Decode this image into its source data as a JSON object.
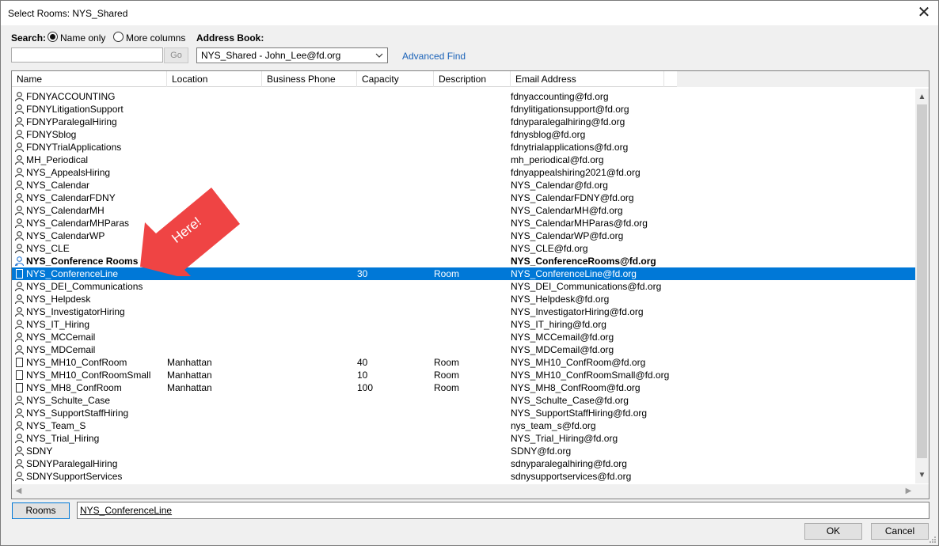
{
  "window": {
    "title": "Select Rooms: NYS_Shared"
  },
  "search": {
    "label": "Search:",
    "option_name_only": "Name only",
    "option_more_columns": "More columns",
    "selected": "Name only",
    "value": "",
    "go_label": "Go"
  },
  "address_book": {
    "label": "Address Book:",
    "selected": "NYS_Shared - John_Lee@fd.org",
    "advanced_find": "Advanced Find"
  },
  "columns": [
    "Name",
    "Location",
    "Business Phone",
    "Capacity",
    "Description",
    "Email Address"
  ],
  "rows": [
    {
      "icon": "person-icon",
      "name": "FDNYACCOUNTING",
      "location": "",
      "phone": "",
      "capacity": "",
      "description": "",
      "email": "fdnyaccounting@fd.org"
    },
    {
      "icon": "person-icon",
      "name": "FDNYLitigationSupport",
      "location": "",
      "phone": "",
      "capacity": "",
      "description": "",
      "email": "fdnylitigationsupport@fd.org"
    },
    {
      "icon": "person-icon",
      "name": "FDNYParalegalHiring",
      "location": "",
      "phone": "",
      "capacity": "",
      "description": "",
      "email": "fdnyparalegalhiring@fd.org"
    },
    {
      "icon": "person-icon",
      "name": "FDNYSblog",
      "location": "",
      "phone": "",
      "capacity": "",
      "description": "",
      "email": "fdnysblog@fd.org"
    },
    {
      "icon": "person-icon",
      "name": "FDNYTrialApplications",
      "location": "",
      "phone": "",
      "capacity": "",
      "description": "",
      "email": "fdnytrialapplications@fd.org"
    },
    {
      "icon": "person-icon",
      "name": "MH_Periodical",
      "location": "",
      "phone": "",
      "capacity": "",
      "description": "",
      "email": "mh_periodical@fd.org"
    },
    {
      "icon": "person-icon",
      "name": "NYS_AppealsHiring",
      "location": "",
      "phone": "",
      "capacity": "",
      "description": "",
      "email": "fdnyappealshiring2021@fd.org"
    },
    {
      "icon": "person-icon",
      "name": "NYS_Calendar",
      "location": "",
      "phone": "",
      "capacity": "",
      "description": "",
      "email": "NYS_Calendar@fd.org"
    },
    {
      "icon": "person-icon",
      "name": "NYS_CalendarFDNY",
      "location": "",
      "phone": "",
      "capacity": "",
      "description": "",
      "email": "NYS_CalendarFDNY@fd.org"
    },
    {
      "icon": "person-icon",
      "name": "NYS_CalendarMH",
      "location": "",
      "phone": "",
      "capacity": "",
      "description": "",
      "email": "NYS_CalendarMH@fd.org"
    },
    {
      "icon": "person-icon",
      "name": "NYS_CalendarMHParas",
      "location": "",
      "phone": "",
      "capacity": "",
      "description": "",
      "email": "NYS_CalendarMHParas@fd.org"
    },
    {
      "icon": "person-icon",
      "name": "NYS_CalendarWP",
      "location": "",
      "phone": "",
      "capacity": "",
      "description": "",
      "email": "NYS_CalendarWP@fd.org"
    },
    {
      "icon": "person-icon",
      "name": "NYS_CLE",
      "location": "",
      "phone": "",
      "capacity": "",
      "description": "",
      "email": "NYS_CLE@fd.org"
    },
    {
      "icon": "group-icon",
      "name": "NYS_Conference Rooms",
      "location": "",
      "phone": "",
      "capacity": "",
      "description": "",
      "email": "NYS_ConferenceRooms@fd.org",
      "bold": true
    },
    {
      "icon": "room-icon",
      "name": "NYS_ConferenceLine",
      "location": "",
      "phone": "",
      "capacity": "30",
      "description": "Room",
      "email": "NYS_ConferenceLine@fd.org",
      "selected": true
    },
    {
      "icon": "person-icon",
      "name": "NYS_DEI_Communications",
      "location": "",
      "phone": "",
      "capacity": "",
      "description": "",
      "email": "NYS_DEI_Communications@fd.org"
    },
    {
      "icon": "person-icon",
      "name": "NYS_Helpdesk",
      "location": "",
      "phone": "",
      "capacity": "",
      "description": "",
      "email": "NYS_Helpdesk@fd.org"
    },
    {
      "icon": "person-icon",
      "name": "NYS_InvestigatorHiring",
      "location": "",
      "phone": "",
      "capacity": "",
      "description": "",
      "email": "NYS_InvestigatorHiring@fd.org"
    },
    {
      "icon": "person-icon",
      "name": "NYS_IT_Hiring",
      "location": "",
      "phone": "",
      "capacity": "",
      "description": "",
      "email": "NYS_IT_hiring@fd.org"
    },
    {
      "icon": "person-icon",
      "name": "NYS_MCCemail",
      "location": "",
      "phone": "",
      "capacity": "",
      "description": "",
      "email": "NYS_MCCemail@fd.org"
    },
    {
      "icon": "person-icon",
      "name": "NYS_MDCemail",
      "location": "",
      "phone": "",
      "capacity": "",
      "description": "",
      "email": "NYS_MDCemail@fd.org"
    },
    {
      "icon": "room-icon",
      "name": "NYS_MH10_ConfRoom",
      "location": "Manhattan",
      "phone": "",
      "capacity": "40",
      "description": "Room",
      "email": "NYS_MH10_ConfRoom@fd.org"
    },
    {
      "icon": "room-icon",
      "name": "NYS_MH10_ConfRoomSmall",
      "location": "Manhattan",
      "phone": "",
      "capacity": "10",
      "description": "Room",
      "email": "NYS_MH10_ConfRoomSmall@fd.org"
    },
    {
      "icon": "room-icon",
      "name": "NYS_MH8_ConfRoom",
      "location": "Manhattan",
      "phone": "",
      "capacity": "100",
      "description": "Room",
      "email": "NYS_MH8_ConfRoom@fd.org"
    },
    {
      "icon": "person-icon",
      "name": "NYS_Schulte_Case",
      "location": "",
      "phone": "",
      "capacity": "",
      "description": "",
      "email": "NYS_Schulte_Case@fd.org"
    },
    {
      "icon": "person-icon",
      "name": "NYS_SupportStaffHiring",
      "location": "",
      "phone": "",
      "capacity": "",
      "description": "",
      "email": "NYS_SupportStaffHiring@fd.org"
    },
    {
      "icon": "person-icon",
      "name": "NYS_Team_S",
      "location": "",
      "phone": "",
      "capacity": "",
      "description": "",
      "email": "nys_team_s@fd.org"
    },
    {
      "icon": "person-icon",
      "name": "NYS_Trial_Hiring",
      "location": "",
      "phone": "",
      "capacity": "",
      "description": "",
      "email": "NYS_Trial_Hiring@fd.org"
    },
    {
      "icon": "person-icon",
      "name": "SDNY",
      "location": "",
      "phone": "",
      "capacity": "",
      "description": "",
      "email": "SDNY@fd.org"
    },
    {
      "icon": "person-icon",
      "name": "SDNYParalegalHiring",
      "location": "",
      "phone": "",
      "capacity": "",
      "description": "",
      "email": "sdnyparalegalhiring@fd.org"
    },
    {
      "icon": "person-icon",
      "name": "SDNYSupportServices",
      "location": "",
      "phone": "",
      "capacity": "",
      "description": "",
      "email": "sdnysupportservices@fd.org"
    }
  ],
  "annotation": {
    "text": "Here!",
    "color": "#ef4444"
  },
  "footer": {
    "rooms_button": "Rooms",
    "rooms_value": "NYS_ConferenceLine",
    "ok_label": "OK",
    "cancel_label": "Cancel"
  },
  "colors": {
    "selection": "#0078d7",
    "link": "#1a62b8"
  }
}
